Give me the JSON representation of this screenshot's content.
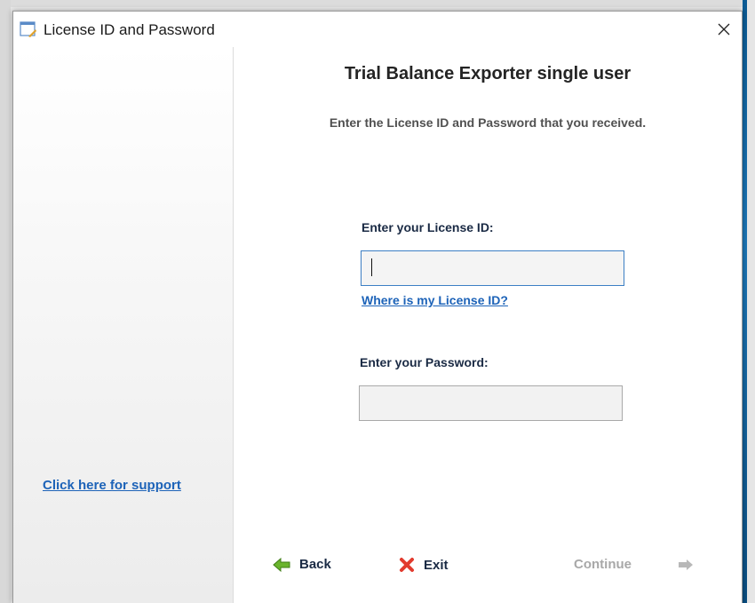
{
  "window": {
    "title": "License ID and Password"
  },
  "sidebar": {
    "support_link": "Click here for support"
  },
  "main": {
    "heading": "Trial Balance Exporter single user",
    "subheading": "Enter the License ID and Password that you received.",
    "license": {
      "label": "Enter your License ID:",
      "value": "",
      "help_link": "Where is my License ID?"
    },
    "password": {
      "label": "Enter your Password:",
      "value": ""
    }
  },
  "nav": {
    "back_label": "Back",
    "exit_label": "Exit",
    "continue_label": "Continue",
    "continue_enabled": false
  },
  "colors": {
    "link": "#1d63b8",
    "back_arrow": "#6ab42d",
    "exit_x": "#e23b2e",
    "disabled": "#a8a8a8"
  },
  "icons": [
    "app-window-icon",
    "close-icon",
    "back-arrow-icon",
    "exit-x-icon",
    "continue-arrow-icon"
  ]
}
